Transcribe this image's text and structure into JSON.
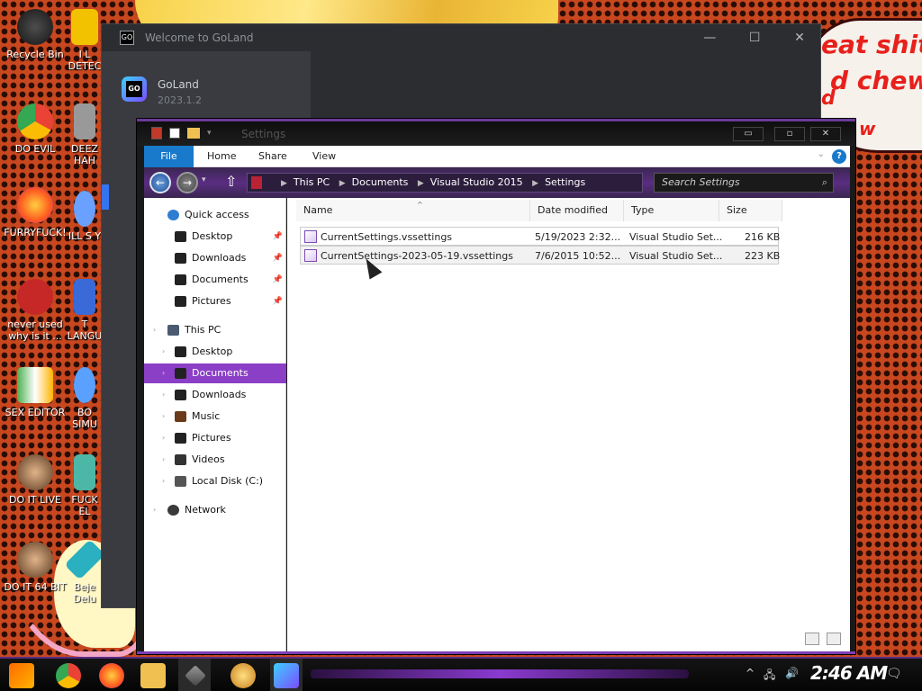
{
  "desktop": {
    "icons": [
      {
        "label": "Recycle Bin",
        "color": "#2d2d2d"
      },
      {
        "label": "DO EVIL",
        "color": "#4285f4"
      },
      {
        "label": "FURRYFUCK!",
        "color": "#ff7139"
      },
      {
        "label": "never used why is it ...",
        "color": "#d32f2f"
      },
      {
        "label": "SEX EDITOR",
        "color": "#f5f5f5"
      },
      {
        "label": "DO IT LIVE",
        "color": "#8b5a3c"
      },
      {
        "label": "DO IT 64 BIT",
        "color": "#8b5a3c"
      }
    ],
    "icons_col2": [
      {
        "label": "I L DETEC",
        "color": "#f2c200"
      },
      {
        "label": "DEEZ HAH",
        "color": "#aaaaaa"
      },
      {
        "label": "ILL S Y",
        "color": "#6aa0ff"
      },
      {
        "label": "T LANGU",
        "color": "#3a6ad8"
      },
      {
        "label": "BO SIMU",
        "color": "#5aa0ff"
      },
      {
        "label": "FUCK EL",
        "color": "#4cb7a6"
      },
      {
        "label": "Beje Delu",
        "color": "#2ab0c0"
      }
    ],
    "bubble_lines": [
      "eat shit",
      "d chew",
      "d",
      "w"
    ]
  },
  "goland": {
    "window_title": "Welcome to GoLand",
    "product_name": "GoLand",
    "product_version": "2023.1.2",
    "icon_text": "GO",
    "minimize": "—",
    "maximize": "☐",
    "close": "✕"
  },
  "explorer": {
    "title": "Settings",
    "ribbon_tabs": [
      "File",
      "Home",
      "Share",
      "View"
    ],
    "breadcrumbs": [
      "This PC",
      "Documents",
      "Visual Studio 2015",
      "Settings"
    ],
    "search_placeholder": "Search Settings",
    "window_buttons": [
      "▭",
      "▫",
      "✕"
    ],
    "nav": {
      "quick_access": {
        "label": "Quick access",
        "items": [
          "Desktop",
          "Downloads",
          "Documents",
          "Pictures"
        ]
      },
      "this_pc": {
        "label": "This PC",
        "items": [
          "Desktop",
          "Documents",
          "Downloads",
          "Music",
          "Pictures",
          "Videos",
          "Local Disk (C:)"
        ]
      },
      "network": "Network",
      "selected": "Documents"
    },
    "columns": [
      "Name",
      "Date modified",
      "Type",
      "Size"
    ],
    "files": [
      {
        "name": "CurrentSettings.vssettings",
        "date": "5/19/2023 2:32...",
        "type": "Visual Studio Set...",
        "size": "216 KB"
      },
      {
        "name": "CurrentSettings-2023-05-19.vssettings",
        "date": "7/6/2015 10:52...",
        "type": "Visual Studio Set...",
        "size": "223 KB"
      }
    ]
  },
  "taskbar": {
    "clock": "2:46 AM",
    "apps": [
      "start-icon",
      "chrome-icon",
      "firefox-icon",
      "explorer-icon",
      "pen-icon",
      "paint-icon",
      "goland-icon"
    ],
    "colors": {
      "accent": "#8a3ad0"
    }
  }
}
